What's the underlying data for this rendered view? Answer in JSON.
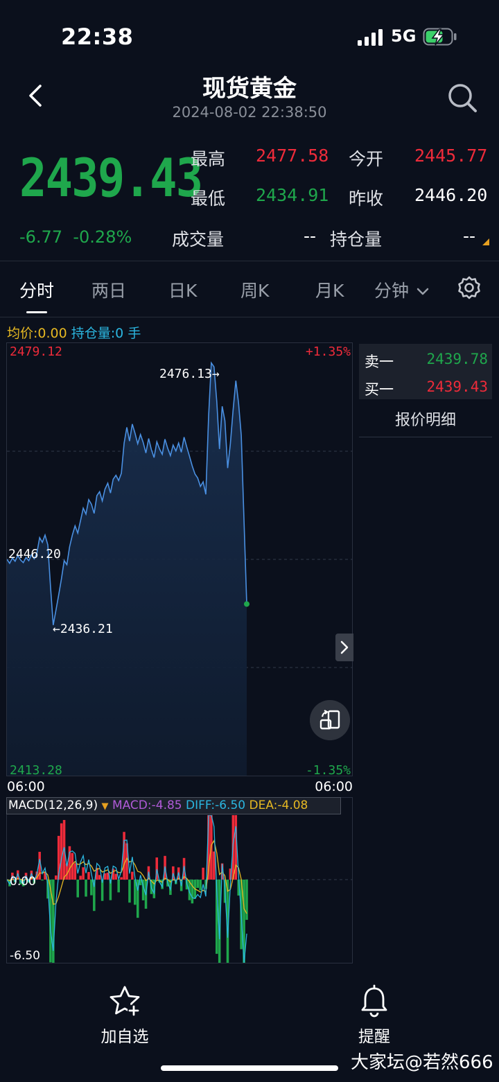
{
  "status_bar": {
    "time": "22:38",
    "network": "5G"
  },
  "header": {
    "title": "现货黄金",
    "datetime": "2024-08-02 22:38:50"
  },
  "quote": {
    "last_price": "2439.43",
    "change": "-6.77",
    "change_pct": "-0.28%",
    "high_label": "最高",
    "high": "2477.58",
    "open_label": "今开",
    "open": "2445.77",
    "low_label": "最低",
    "low": "2434.91",
    "prev_close_label": "昨收",
    "prev_close": "2446.20",
    "volume_label": "成交量",
    "volume": "--",
    "open_interest_label": "持仓量",
    "open_interest": "--"
  },
  "tabs": [
    {
      "label": "分时"
    },
    {
      "label": "两日"
    },
    {
      "label": "日K"
    },
    {
      "label": "周K"
    },
    {
      "label": "月K"
    },
    {
      "label": "分钟"
    }
  ],
  "info_line": {
    "avg_label": "均价:",
    "avg_value": "0.00",
    "oi_label": "持仓量:",
    "oi_value": "0",
    "oi_unit": "手"
  },
  "order_book": {
    "ask_label": "卖一",
    "ask": "2439.78",
    "bid_label": "买一",
    "bid": "2439.43",
    "detail_label": "报价明细"
  },
  "chart_data": [
    {
      "type": "line",
      "y_max_label": "2479.12",
      "y_min_label": "2413.28",
      "pct_max_label": "+1.35%",
      "pct_min_label": "-1.35%",
      "ref_label": "2446.20",
      "ylim": [
        2413.28,
        2479.12
      ],
      "reference": 2446.2,
      "x_start_label": "06:00",
      "x_end_label": "06:00",
      "high_marker": "2476.13→",
      "low_marker": "←2436.21",
      "series": [
        {
          "values": [
            2446.2,
            2445.6,
            2446.4,
            2445.9,
            2446.8,
            2446.1,
            2445.7,
            2446.5,
            2446.0,
            2446.9,
            2446.3,
            2447.2,
            2449.5,
            2448.8,
            2449.9,
            2448.4,
            2442.0,
            2436.2,
            2438.5,
            2440.8,
            2443.2,
            2446.0,
            2445.4,
            2448.1,
            2449.9,
            2451.3,
            2450.2,
            2452.1,
            2454.0,
            2453.1,
            2455.3,
            2454.6,
            2453.2,
            2455.9,
            2456.5,
            2455.1,
            2456.9,
            2457.8,
            2456.3,
            2458.4,
            2459.0,
            2458.2,
            2459.3,
            2463.9,
            2466.3,
            2464.2,
            2466.8,
            2465.4,
            2463.8,
            2465.2,
            2464.0,
            2462.4,
            2464.6,
            2462.9,
            2461.7,
            2464.1,
            2463.0,
            2462.2,
            2464.5,
            2463.1,
            2462.0,
            2463.6,
            2462.7,
            2463.9,
            2462.5,
            2464.8,
            2463.3,
            2461.9,
            2460.4,
            2459.2,
            2458.6,
            2457.3,
            2458.0,
            2456.1,
            2468.0,
            2476.1,
            2475.5,
            2470.2,
            2463.0,
            2469.5,
            2467.3,
            2460.1,
            2463.8,
            2468.9,
            2473.4,
            2470.0,
            2465.1,
            2452.0,
            2439.4
          ],
          "color": "#4a90e2"
        }
      ]
    },
    {
      "type": "bar",
      "title": "MACD(12,26,9)",
      "macd_label": "MACD:-4.85",
      "diff_label": "DIFF:-6.50",
      "dea_label": "DEA:-4.08",
      "zero_label": "0.00",
      "min_label": "-6.50",
      "macd": -4.85,
      "diff": -6.5,
      "dea": -4.08,
      "colors": {
        "macd": "#b05ad8",
        "diff": "#2bb6e0",
        "dea": "#e6b822",
        "up": "#ee2b3a",
        "down": "#1fa74c"
      }
    }
  ],
  "bottom_bar": {
    "add_watch_label": "加自选",
    "alert_label": "提醒"
  },
  "watermark": "大家坛@若然666"
}
